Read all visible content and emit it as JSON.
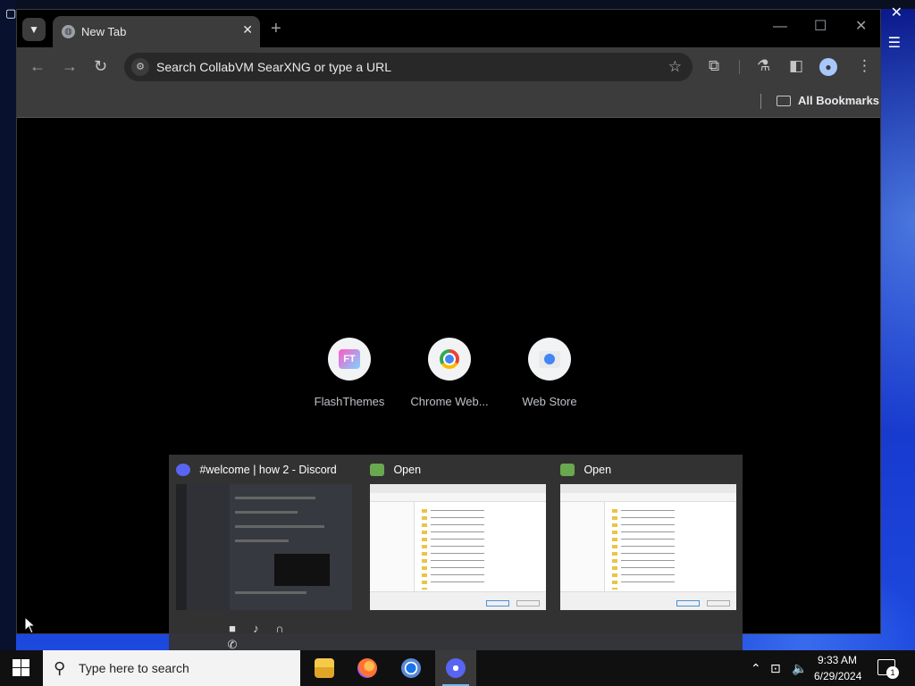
{
  "browser": {
    "tab": {
      "title": "New Tab"
    },
    "omnibox": {
      "placeholder": "Search CollabVM SearXNG or type a URL"
    },
    "bookmarks_bar": {
      "all_bookmarks_label": "All Bookmarks"
    },
    "shortcuts": [
      {
        "label": "FlashThemes",
        "icon": "flashthemes-logo"
      },
      {
        "label": "Chrome Web...",
        "icon": "chrome-logo"
      },
      {
        "label": "Web Store",
        "icon": "web-store-logo"
      }
    ]
  },
  "thumbnails": [
    {
      "title": "#welcome | how 2 - Discord",
      "app": "discord",
      "icon_color": "#5865f2"
    },
    {
      "title": "Open",
      "app": "file-dialog",
      "icon_color": "#6aa84f"
    },
    {
      "title": "Open",
      "app": "file-dialog",
      "icon_color": "#6aa84f"
    }
  ],
  "taskbar": {
    "search_placeholder": "Type here to search",
    "clock": {
      "time": "9:33 AM",
      "date": "6/29/2024"
    },
    "notification_count": "1"
  },
  "colors": {
    "accent": "#76b9ed",
    "toolbar": "#3c3c3c",
    "discord": "#5865f2"
  }
}
